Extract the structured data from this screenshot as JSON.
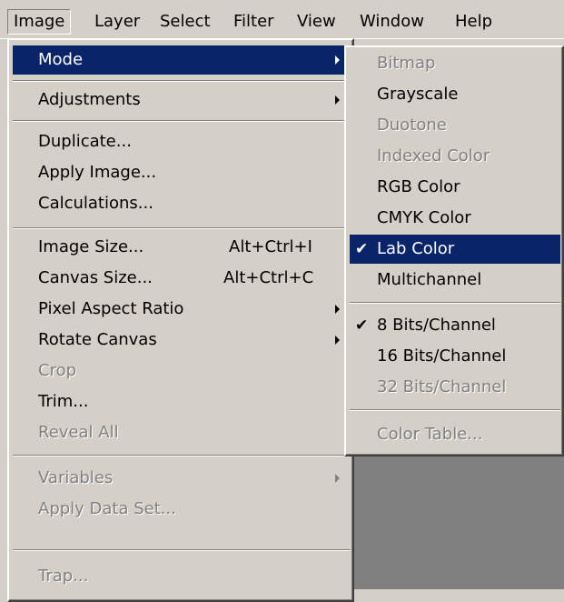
{
  "menubar": {
    "items": [
      "Image",
      "Layer",
      "Select",
      "Filter",
      "View",
      "Window",
      "Help"
    ]
  },
  "image_menu": {
    "mode": "Mode",
    "adjustments": "Adjustments",
    "duplicate": "Duplicate...",
    "apply_image": "Apply Image...",
    "calculations": "Calculations...",
    "image_size": "Image Size...",
    "image_size_shortcut": "Alt+Ctrl+I",
    "canvas_size": "Canvas Size...",
    "canvas_size_shortcut": "Alt+Ctrl+C",
    "pixel_aspect_ratio": "Pixel Aspect Ratio",
    "rotate_canvas": "Rotate Canvas",
    "crop": "Crop",
    "trim": "Trim...",
    "reveal_all": "Reveal All",
    "variables": "Variables",
    "apply_data_set": "Apply Data Set...",
    "trap": "Trap..."
  },
  "mode_submenu": {
    "bitmap": "Bitmap",
    "grayscale": "Grayscale",
    "duotone": "Duotone",
    "indexed_color": "Indexed Color",
    "rgb_color": "RGB Color",
    "cmyk_color": "CMYK Color",
    "lab_color": "Lab Color",
    "multichannel": "Multichannel",
    "bits_8": "8 Bits/Channel",
    "bits_16": "16 Bits/Channel",
    "bits_32": "32 Bits/Channel",
    "color_table": "Color Table...",
    "check_mark": "✔"
  },
  "colors": {
    "menu_face": "#d4d0c8",
    "highlight": "#0a246a",
    "disabled_text": "#808080",
    "workspace": "#808080"
  },
  "icons": {
    "submenu_arrow": "triangle-right",
    "checked": "check-mark"
  }
}
